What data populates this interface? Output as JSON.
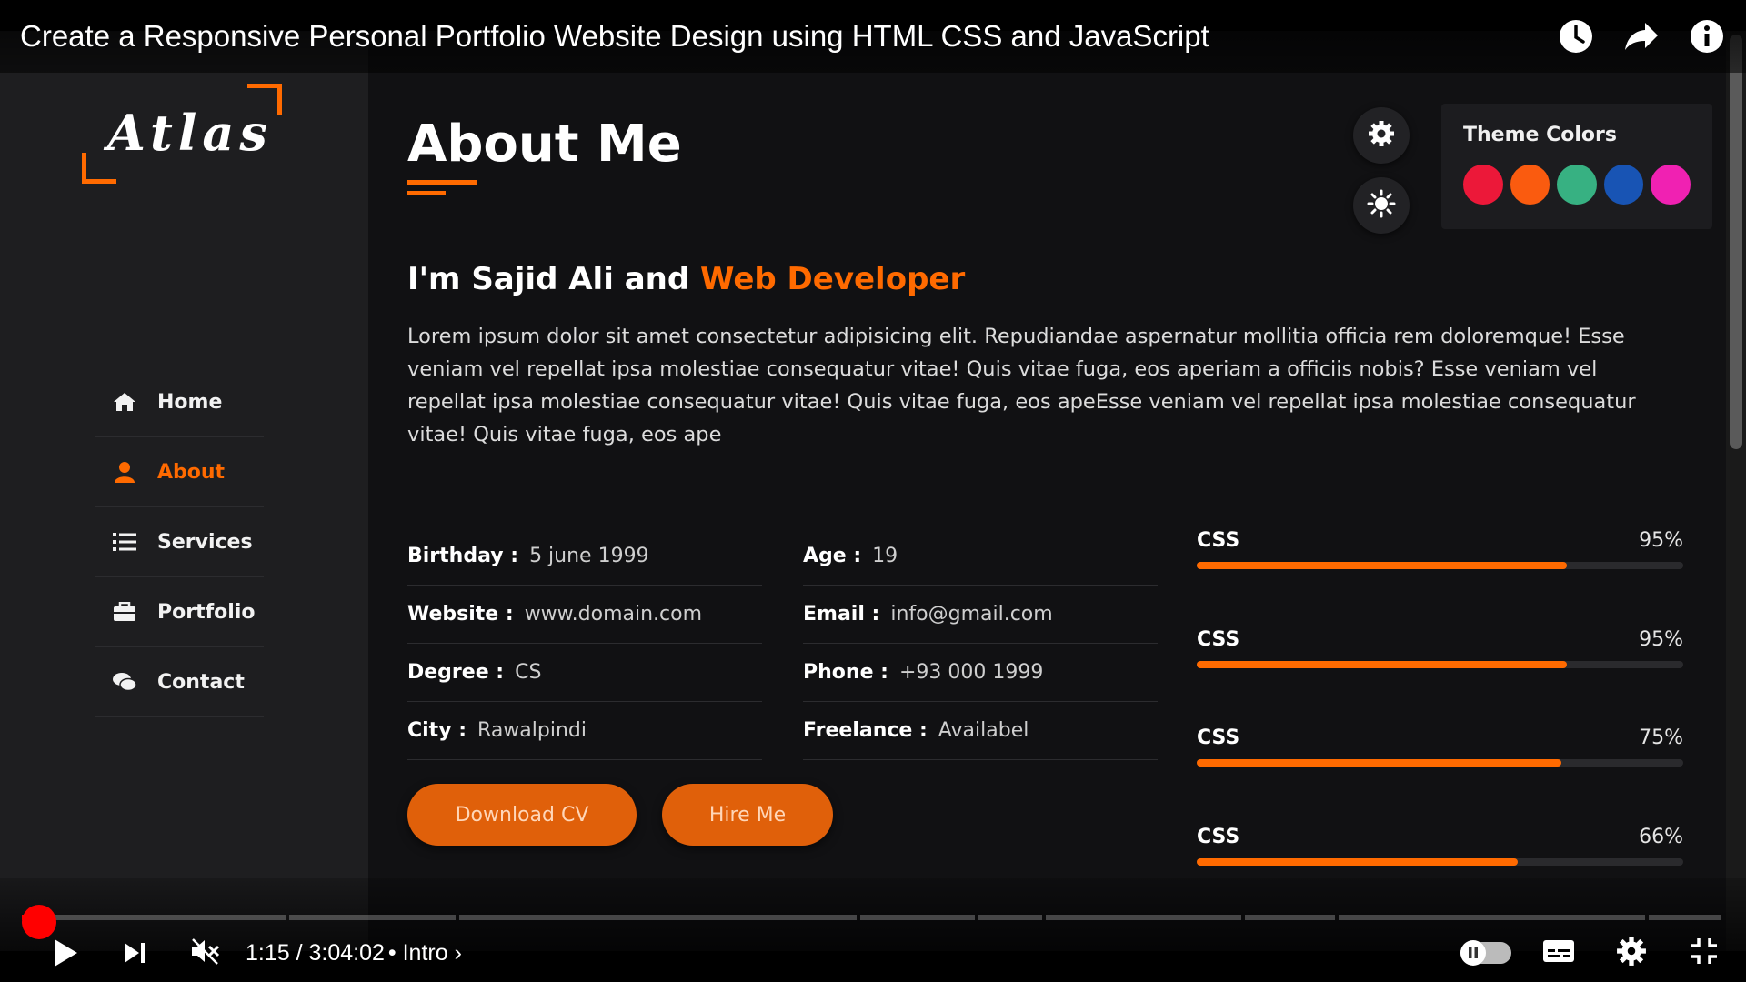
{
  "video": {
    "title": "Create a Responsive Personal Portfolio Website Design using HTML CSS and JavaScript",
    "time_display": "1:15 / 3:04:02",
    "chapter": "• Intro ›",
    "played_fraction": 0.007
  },
  "site": {
    "logo": "Atlas",
    "nav": [
      {
        "label": "Home",
        "icon": "home-icon"
      },
      {
        "label": "About",
        "icon": "user-icon",
        "active": true
      },
      {
        "label": "Services",
        "icon": "list-icon"
      },
      {
        "label": "Portfolio",
        "icon": "briefcase-icon"
      },
      {
        "label": "Contact",
        "icon": "comments-icon"
      }
    ],
    "page_title": "About Me",
    "intro_prefix": "I'm Sajid Ali and ",
    "intro_role": "Web Developer",
    "bio": "Lorem ipsum dolor sit amet consectetur adipisicing elit. Repudiandae aspernatur mollitia officia rem doloremque! Esse veniam vel repellat ipsa molestiae consequatur vitae! Quis vitae fuga, eos aperiam a officiis nobis? Esse veniam vel repellat ipsa molestiae consequatur vitae! Quis vitae fuga, eos apeEsse veniam vel repellat ipsa molestiae consequatur vitae! Quis vitae fuga, eos ape",
    "info": [
      {
        "label": "Birthday :",
        "value": "5 june 1999"
      },
      {
        "label": "Age :",
        "value": "19"
      },
      {
        "label": "Website :",
        "value": "www.domain.com"
      },
      {
        "label": "Email :",
        "value": "info@gmail.com"
      },
      {
        "label": "Degree :",
        "value": "CS"
      },
      {
        "label": "Phone :",
        "value": "+93 000 1999"
      },
      {
        "label": "City :",
        "value": "Rawalpindi"
      },
      {
        "label": "Freelance :",
        "value": "Availabel"
      }
    ],
    "buttons": {
      "download": "Download CV",
      "hire": "Hire Me"
    },
    "skills": [
      {
        "name": "CSS",
        "percent_label": "95%",
        "fill": 0.76
      },
      {
        "name": "CSS",
        "percent_label": "95%",
        "fill": 0.76
      },
      {
        "name": "CSS",
        "percent_label": "75%",
        "fill": 0.75
      },
      {
        "name": "CSS",
        "percent_label": "66%",
        "fill": 0.66
      }
    ],
    "theme_panel": {
      "title": "Theme Colors",
      "colors": [
        "#ec1839",
        "#fa5b0f",
        "#37b182",
        "#1854b4",
        "#f021b2"
      ]
    },
    "accent_color": "#ff6a00"
  }
}
